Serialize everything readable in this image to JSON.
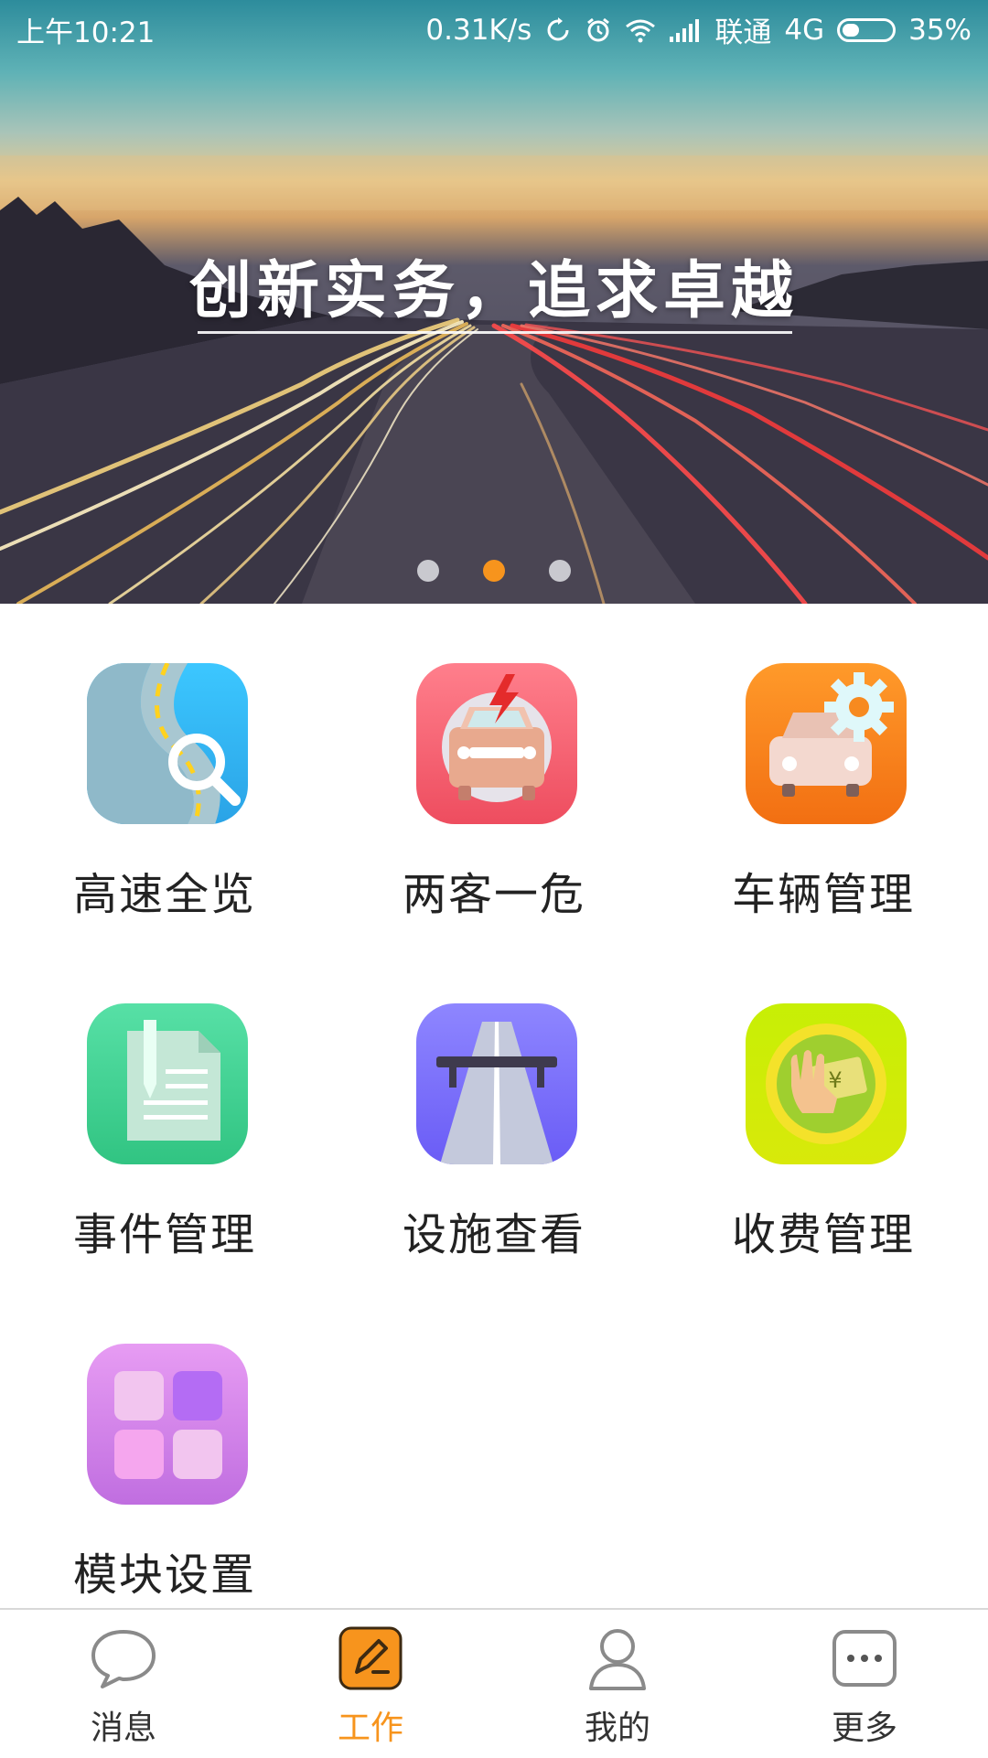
{
  "status_bar": {
    "time": "上午10:21",
    "speed": "0.31K/s",
    "carrier": "联通",
    "network": "4G",
    "battery": "35%",
    "battery_level": 0.35,
    "icons": [
      "sync-icon",
      "alarm-icon",
      "wifi-icon",
      "signal-icon",
      "battery-icon"
    ]
  },
  "banner": {
    "slogan": "创新实务，追求卓越",
    "carousel": {
      "count": 3,
      "active_index": 1
    }
  },
  "modules": [
    {
      "label": "高速全览",
      "icon": "highway-map-search-icon",
      "color": "#35b6f0"
    },
    {
      "label": "两客一危",
      "icon": "bus-danger-icon",
      "color": "#f2616f"
    },
    {
      "label": "车辆管理",
      "icon": "vehicle-settings-icon",
      "color": "#fb7d1e"
    },
    {
      "label": "事件管理",
      "icon": "document-edit-icon",
      "color": "#3fcf93"
    },
    {
      "label": "设施查看",
      "icon": "road-facility-icon",
      "color": "#7469ff"
    },
    {
      "label": "收费管理",
      "icon": "toll-payment-icon",
      "color": "#b4e404"
    },
    {
      "label": "模块设置",
      "icon": "grid-settings-icon",
      "color": "#c47ae8"
    }
  ],
  "bottom_nav": {
    "active_index": 1,
    "accent": "#f7941d",
    "items": [
      {
        "label": "消息",
        "icon": "chat-bubble-icon"
      },
      {
        "label": "工作",
        "icon": "work-edit-icon"
      },
      {
        "label": "我的",
        "icon": "user-icon"
      },
      {
        "label": "更多",
        "icon": "more-dots-icon"
      }
    ]
  }
}
